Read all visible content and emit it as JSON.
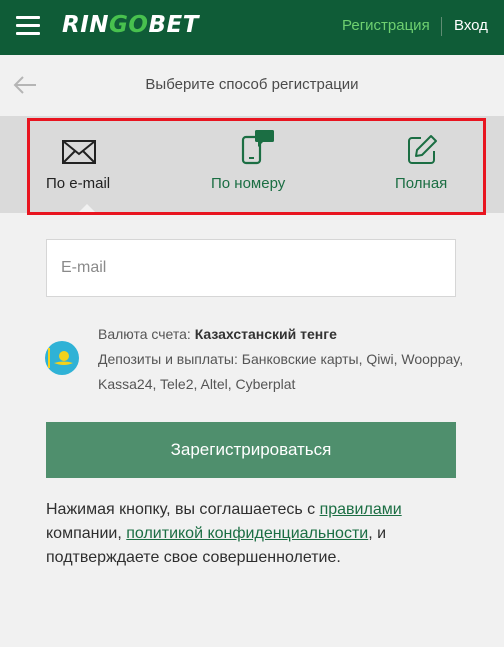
{
  "header": {
    "logo_part1": "RIN",
    "logo_part2": "GO",
    "logo_part3": "BET",
    "register_link": "Регистрация",
    "login_link": "Вход",
    "bg_color": "#0f5c37"
  },
  "subheader": {
    "title": "Выберите способ регистрации"
  },
  "tabs": [
    {
      "label": "По e-mail",
      "icon": "envelope-icon",
      "active": true
    },
    {
      "label": "По номеру",
      "icon": "phone-message-icon",
      "active": false
    },
    {
      "label": "Полная",
      "icon": "edit-icon",
      "active": false
    }
  ],
  "form": {
    "email_placeholder": "E-mail",
    "email_value": "",
    "currency_label": "Валюта счета:",
    "currency_value": "Казахстанский тенге",
    "payments_text": "Депозиты и выплаты: Банковские карты, Qiwi, Wooppay, Kassa24, Tele2, Altel, Cyberplat",
    "submit_label": "Зарегистрироваться",
    "accent_color": "#4f8f6d"
  },
  "terms": {
    "text_before": "Нажимая кнопку, вы соглашаетесь с ",
    "rules_link": "правилами",
    "text_middle": " компании, ",
    "privacy_link": "политикой конфиденциальности",
    "text_after": ", и подтверждаете свое совершеннолетие."
  }
}
